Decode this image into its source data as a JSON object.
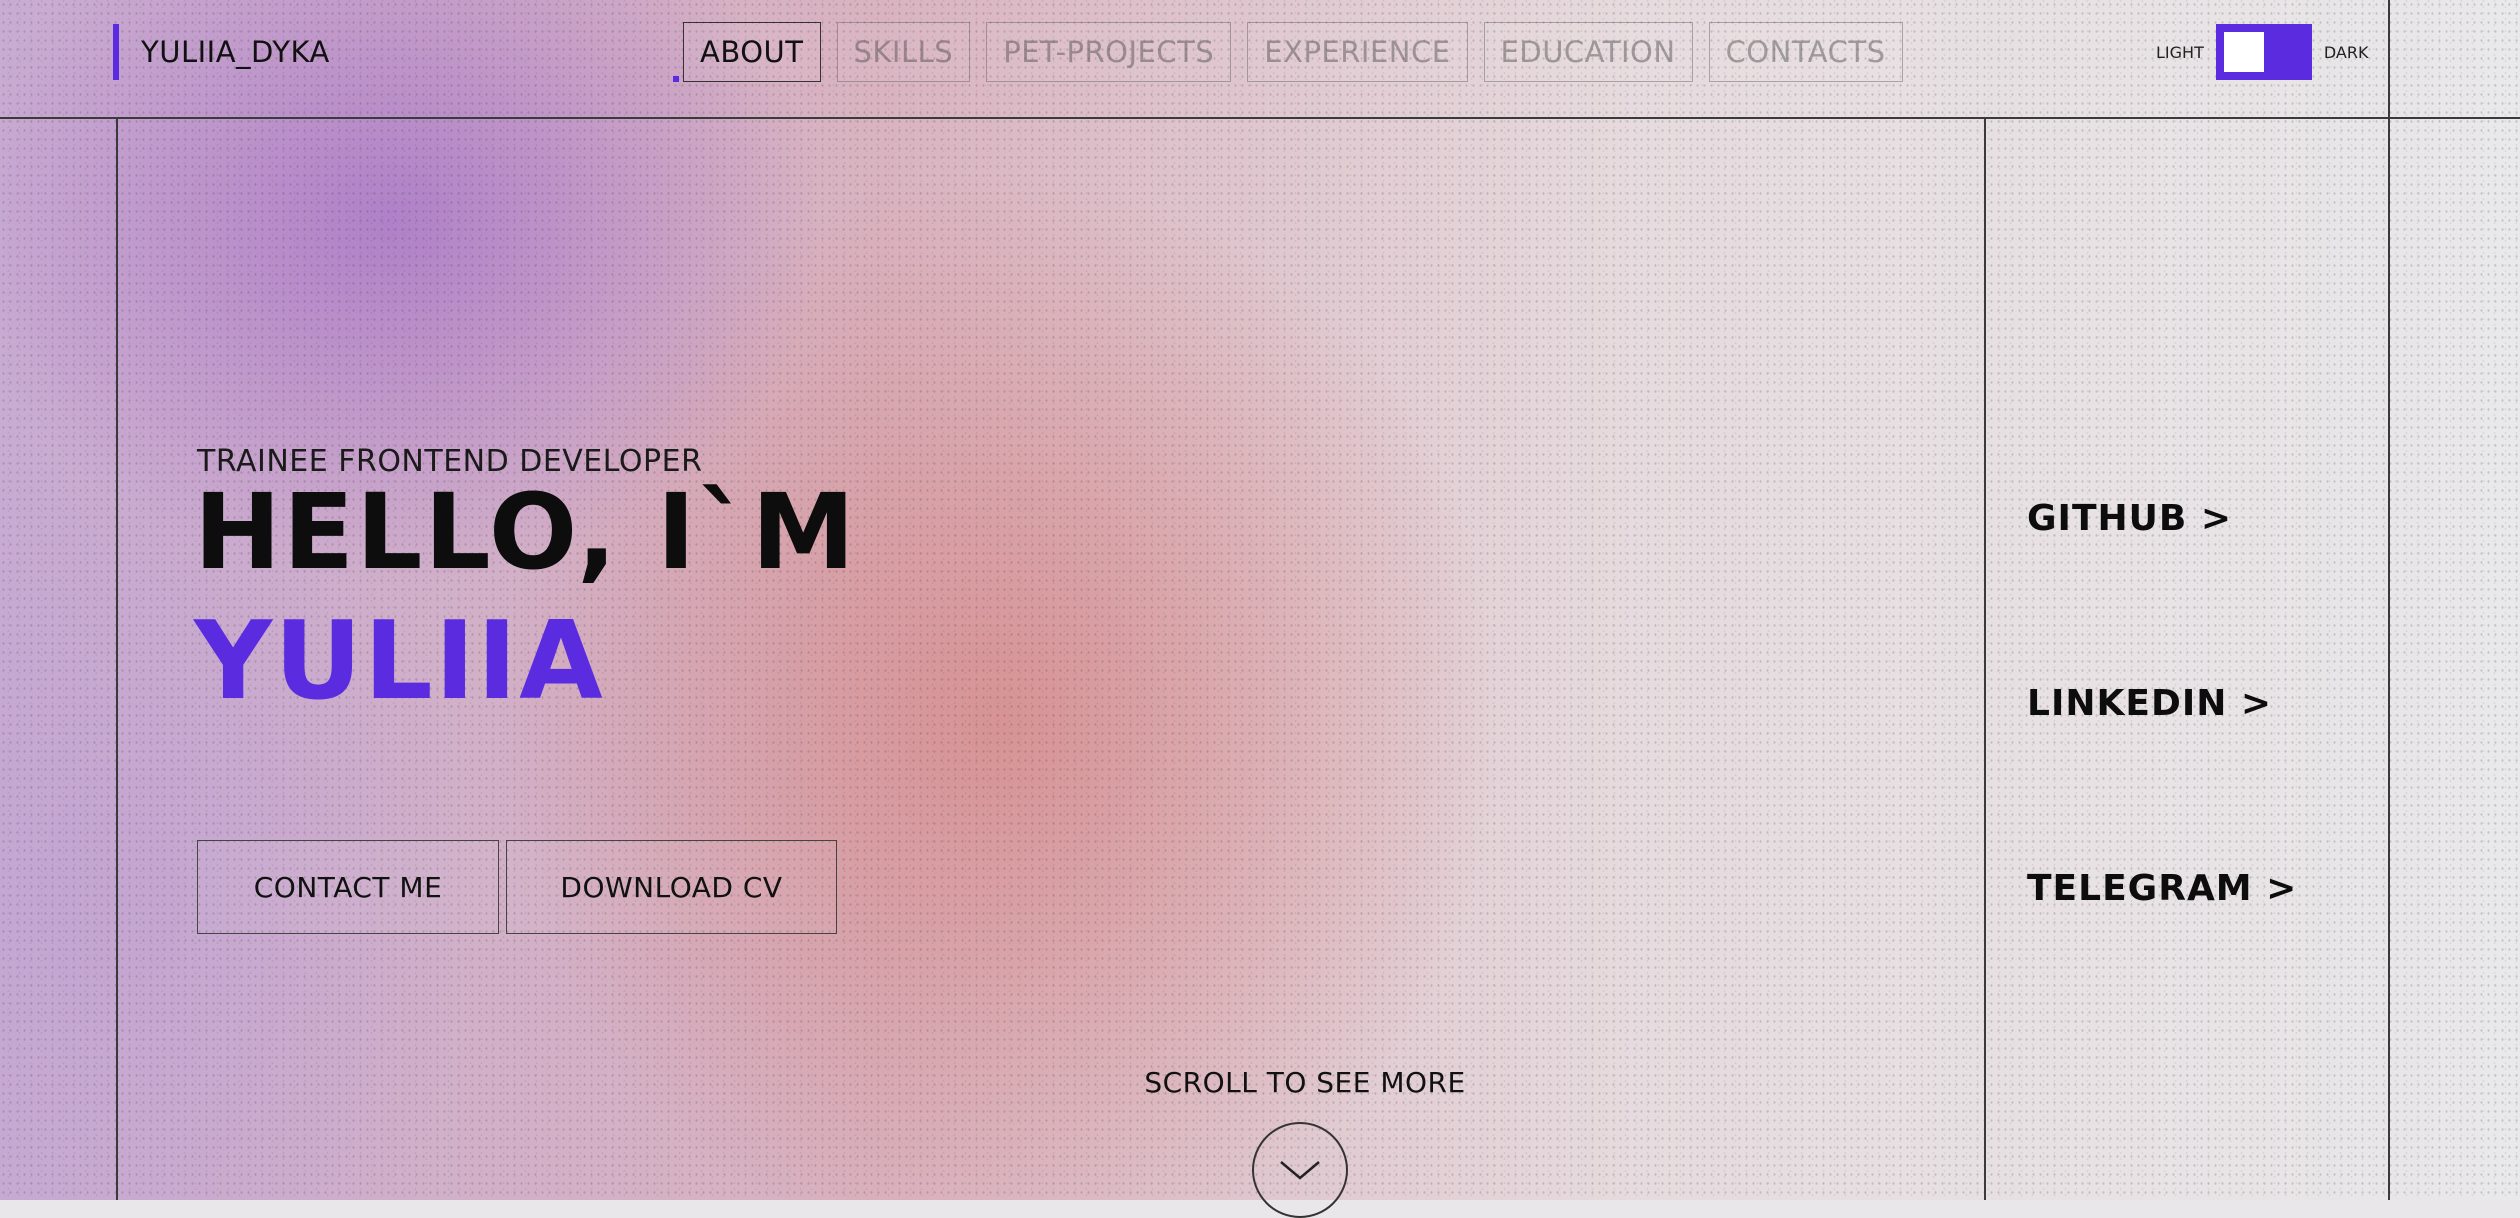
{
  "header": {
    "logo": "YULIIA_DYKA",
    "nav": [
      {
        "label": "ABOUT",
        "active": true
      },
      {
        "label": "SKILLS",
        "active": false
      },
      {
        "label": "PET-PROJECTS",
        "active": false
      },
      {
        "label": "EXPERIENCE",
        "active": false
      },
      {
        "label": "EDUCATION",
        "active": false
      },
      {
        "label": "CONTACTS",
        "active": false
      }
    ],
    "theme": {
      "light_label": "LIGHT",
      "dark_label": "DARK"
    }
  },
  "hero": {
    "subtitle": "TRAINEE FRONTEND DEVELOPER",
    "greeting": "HELLO, I`M",
    "name": "YULIIA",
    "buttons": {
      "contact": "CONTACT ME",
      "download": "DOWNLOAD CV"
    },
    "scroll_label": "SCROLL TO SEE MORE"
  },
  "social": {
    "links": [
      {
        "label": "GITHUB >"
      },
      {
        "label": "LINKEDIN >"
      },
      {
        "label": "TELEGRAM >"
      }
    ]
  },
  "colors": {
    "accent": "#5b2be0",
    "text": "#111111"
  }
}
